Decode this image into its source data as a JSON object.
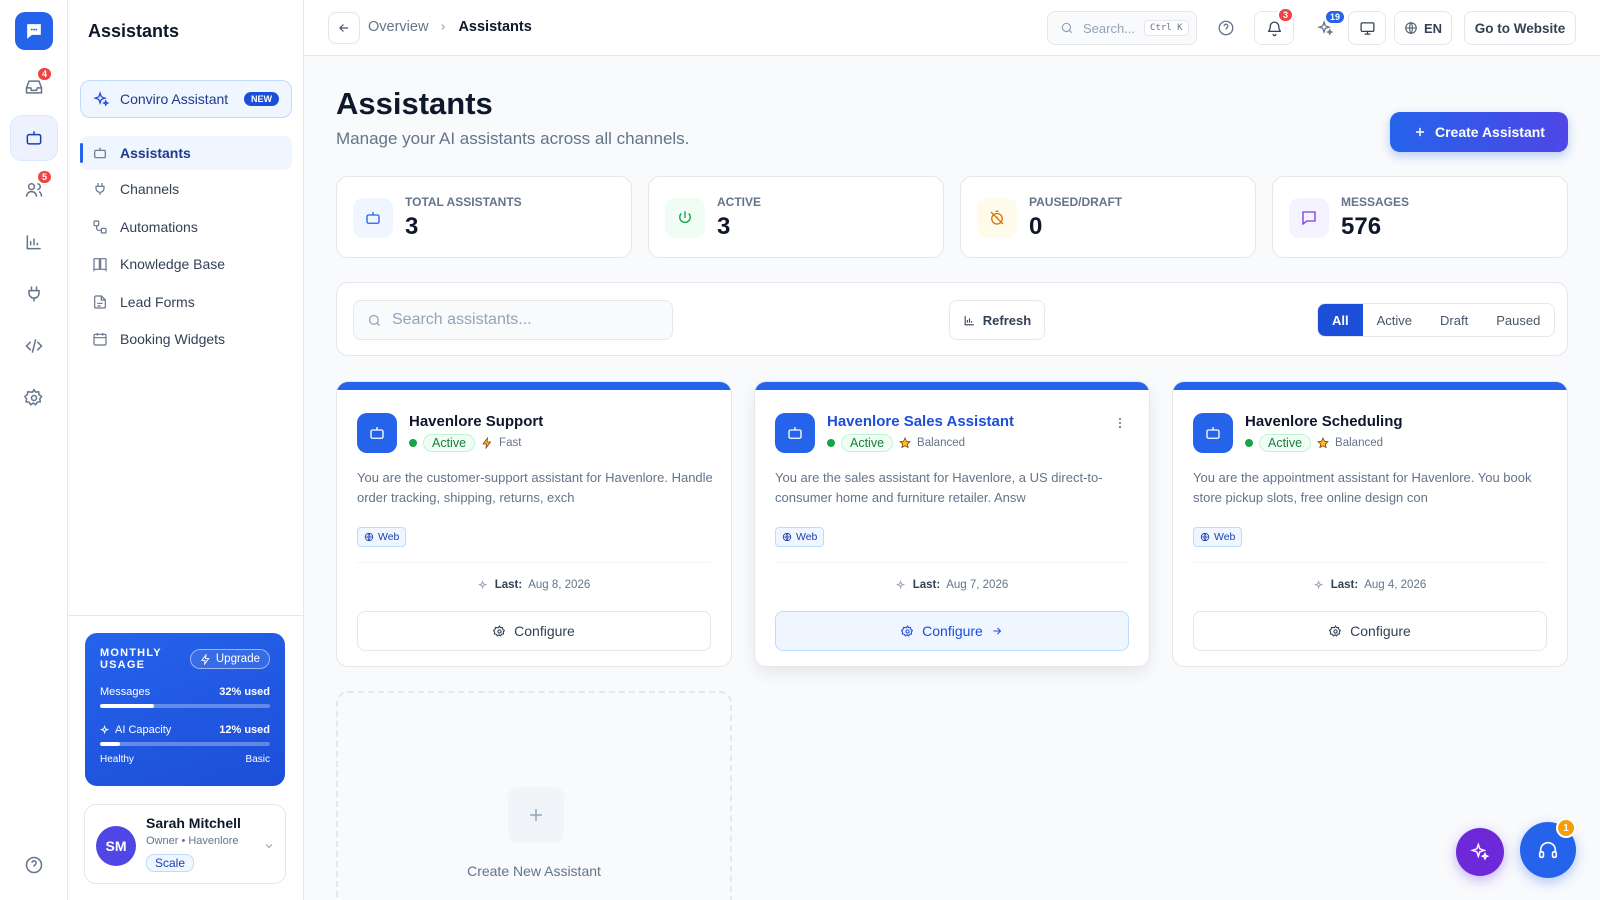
{
  "rail": {
    "inbox_badge": "4",
    "contacts_badge": "5"
  },
  "sidebar": {
    "title": "Assistants",
    "assistant_promo": {
      "label": "Conviro Assistant",
      "badge": "NEW"
    },
    "items": [
      {
        "label": "Assistants",
        "icon": "bot-icon"
      },
      {
        "label": "Channels",
        "icon": "plug-icon"
      },
      {
        "label": "Automations",
        "icon": "workflow-icon"
      },
      {
        "label": "Knowledge Base",
        "icon": "book-icon"
      },
      {
        "label": "Lead Forms",
        "icon": "form-icon"
      },
      {
        "label": "Booking Widgets",
        "icon": "calendar-icon"
      }
    ],
    "usage": {
      "title": "MONTHLY USAGE",
      "upgrade_label": "Upgrade",
      "messages_label": "Messages",
      "messages_value": "32% used",
      "messages_pct": 32,
      "ai_label": "AI Capacity",
      "ai_value": "12% used",
      "ai_pct": 12,
      "status": "Healthy",
      "plan": "Basic"
    },
    "user": {
      "initials": "SM",
      "name": "Sarah Mitchell",
      "role": "Owner • Havenlore",
      "plan_badge": "Scale"
    }
  },
  "topbar": {
    "breadcrumb_parent": "Overview",
    "breadcrumb_current": "Assistants",
    "search_placeholder": "Search...",
    "search_shortcut": "Ctrl K",
    "notifications_badge": "3",
    "spark_badge": "19",
    "language": "EN",
    "website_button": "Go to Website"
  },
  "page": {
    "title": "Assistants",
    "subtitle": "Manage your AI assistants across all channels.",
    "create_button": "Create Assistant"
  },
  "stats": [
    {
      "label": "TOTAL ASSISTANTS",
      "value": "3",
      "icon": "bot-icon",
      "color": "#2563eb",
      "bg": "#eff6ff"
    },
    {
      "label": "ACTIVE",
      "value": "3",
      "icon": "power-icon",
      "color": "#16a34a",
      "bg": "#f0fdf4"
    },
    {
      "label": "PAUSED/DRAFT",
      "value": "0",
      "icon": "timer-off-icon",
      "color": "#d97706",
      "bg": "#fffbeb"
    },
    {
      "label": "MESSAGES",
      "value": "576",
      "icon": "message-icon",
      "color": "#7c3aed",
      "bg": "#f5f3ff"
    }
  ],
  "filters": {
    "search_placeholder": "Search assistants...",
    "refresh_label": "Refresh",
    "tabs": [
      "All",
      "Active",
      "Draft",
      "Paused"
    ],
    "active_tab": "All"
  },
  "assistants": [
    {
      "name": "Havenlore Support",
      "status": "Active",
      "mode": "Fast",
      "description": "You are the customer-support assistant for Havenlore. Handle order tracking, shipping, returns, exch",
      "channel": "Web",
      "last_label": "Last:",
      "last_date": "Aug 8, 2026",
      "configure_label": "Configure"
    },
    {
      "name": "Havenlore Sales Assistant",
      "status": "Active",
      "mode": "Balanced",
      "description": "You are the sales assistant for Havenlore, a US direct-to-consumer home and furniture retailer. Answ",
      "channel": "Web",
      "last_label": "Last:",
      "last_date": "Aug 7, 2026",
      "configure_label": "Configure"
    },
    {
      "name": "Havenlore Scheduling",
      "status": "Active",
      "mode": "Balanced",
      "description": "You are the appointment assistant for Havenlore. You book store pickup slots, free online design con",
      "channel": "Web",
      "last_label": "Last:",
      "last_date": "Aug 4, 2026",
      "configure_label": "Configure"
    }
  ],
  "new_assistant_label": "Create New Assistant",
  "support_badge": "1"
}
